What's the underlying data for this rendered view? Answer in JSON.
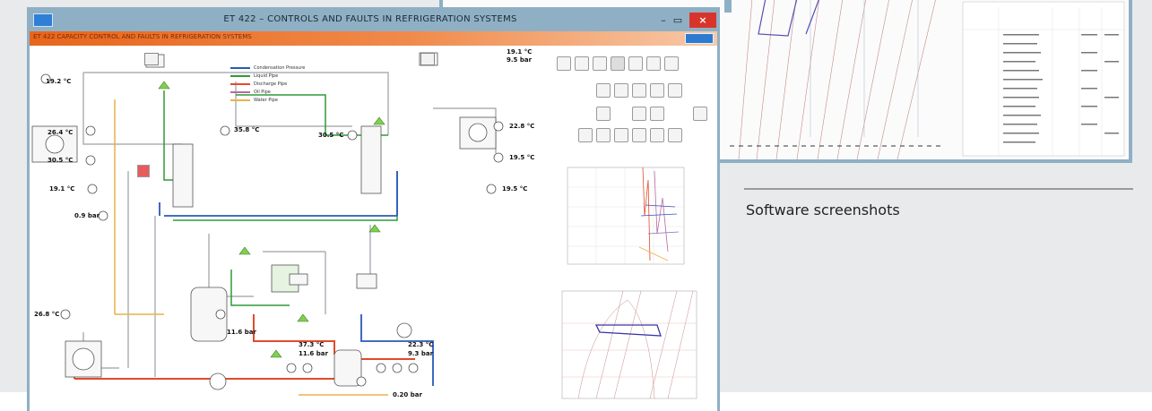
{
  "window": {
    "title": "ET 422 – CONTROLS AND FAULTS IN REFRIGERATION SYSTEMS",
    "minimize": "–",
    "maximize": "▭",
    "close": "×"
  },
  "toolbar": {
    "text": "ET 422 CAPACITY CONTROL AND FAULTS IN REFRIGERATION SYSTEMS"
  },
  "legend": [
    {
      "label": "Condensation Pressure",
      "color": "#2b58b8"
    },
    {
      "label": "Liquid Pipe",
      "color": "#2f9a3a"
    },
    {
      "label": "Discharge Pipe",
      "color": "#e14b2b"
    },
    {
      "label": "Oil Pipe",
      "color": "#b66aa0"
    },
    {
      "label": "Water Pipe",
      "color": "#e8b24a"
    }
  ],
  "readings": {
    "t_top_left": "19.2 °C",
    "t_left_1": "26.4 °C",
    "t_left_2": "30.5 °C",
    "t_left_3": "19.1 °C",
    "p_left": "0.9 bar",
    "t_mid_top": "35.8 °C",
    "t_mid": "30.5 °C",
    "t_right_top": "19.1 °C",
    "p_right_top": "9.5 bar",
    "t_right_1": "22.8 °C",
    "t_right_2": "19.5 °C",
    "t_right_3": "19.5 °C",
    "t_lower_left": "26.8 °C",
    "p_lower_mid": "11.6 bar",
    "t_bottom_1": "37.3 °C",
    "p_bottom_1": "11.6 bar",
    "t_bottom_2": "22.3 °C",
    "p_bottom_2": "9.3 bar",
    "p_bottom_3": "0.20 bar"
  },
  "caption": "Software screenshots",
  "colors": {
    "window_frame": "#8fb0c4",
    "accent_orange": "#e8651b",
    "close_red": "#d9342b"
  }
}
